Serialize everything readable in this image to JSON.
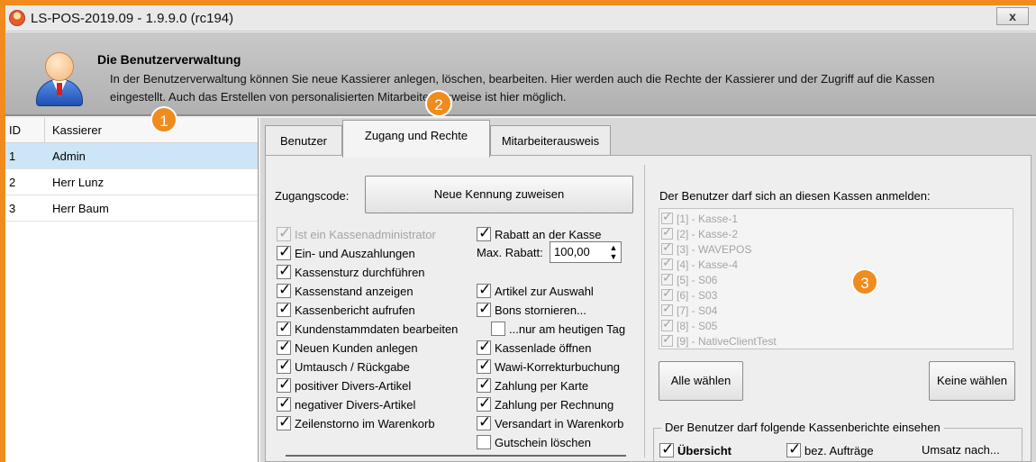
{
  "window": {
    "title": "LS-POS-2019.09 - 1.9.9.0 (rc194)",
    "close_label": "x"
  },
  "header": {
    "title": "Die Benutzerverwaltung",
    "description": "In der Benutzerverwaltung können Sie neue Kassierer anlegen, löschen, bearbeiten. Hier werden auch die Rechte der Kassierer und der Zugriff auf die Kassen eingestellt. Auch das Erstellen von personalisierten Mitarbeiterausweise ist hier möglich."
  },
  "userlist": {
    "columns": [
      "ID",
      "Kassierer"
    ],
    "rows": [
      {
        "id": "1",
        "name": "Admin",
        "selected": true
      },
      {
        "id": "2",
        "name": "Herr Lunz",
        "selected": false
      },
      {
        "id": "3",
        "name": "Herr Baum",
        "selected": false
      }
    ]
  },
  "badges": [
    "1",
    "2",
    "3"
  ],
  "tabs": [
    {
      "label": "Benutzer",
      "active": false
    },
    {
      "label": "Zugang und Rechte",
      "active": true
    },
    {
      "label": "Mitarbeiterausweis",
      "active": false
    }
  ],
  "access": {
    "code_label": "Zugangscode:",
    "assign_button": "Neue Kennung zuweisen",
    "max_rabatt_label": "Max. Rabatt:",
    "max_rabatt_value": "100,00"
  },
  "rights_left": [
    {
      "label": "Ist ein Kassenadministrator",
      "checked": true,
      "disabled": true
    },
    {
      "label": "Ein- und Auszahlungen",
      "checked": true,
      "disabled": false
    },
    {
      "label": "Kassensturz durchführen",
      "checked": true,
      "disabled": false
    },
    {
      "label": "Kassenstand anzeigen",
      "checked": true,
      "disabled": false
    },
    {
      "label": "Kassenbericht aufrufen",
      "checked": true,
      "disabled": false
    },
    {
      "label": "Kundenstammdaten bearbeiten",
      "checked": true,
      "disabled": false
    },
    {
      "label": "Neuen Kunden anlegen",
      "checked": true,
      "disabled": false
    },
    {
      "label": "Umtausch / Rückgabe",
      "checked": true,
      "disabled": false
    },
    {
      "label": "positiver Divers-Artikel",
      "checked": true,
      "disabled": false
    },
    {
      "label": "negativer Divers-Artikel",
      "checked": true,
      "disabled": false
    },
    {
      "label": "Zeilenstorno im Warenkorb",
      "checked": true,
      "disabled": false
    }
  ],
  "rights_right": [
    {
      "label": "Rabatt an der Kasse",
      "checked": true
    },
    {
      "label": "Artikel zur Auswahl",
      "checked": true
    },
    {
      "label": "Bons stornieren...",
      "checked": true
    },
    {
      "label": "...nur am heutigen Tag",
      "checked": false
    },
    {
      "label": "Kassenlade öffnen",
      "checked": true
    },
    {
      "label": "Wawi-Korrekturbuchung",
      "checked": true
    },
    {
      "label": "Zahlung per Karte",
      "checked": true
    },
    {
      "label": "Zahlung per Rechnung",
      "checked": true
    },
    {
      "label": "Versandart in Warenkorb",
      "checked": true
    },
    {
      "label": "Gutschein löschen",
      "checked": false
    }
  ],
  "kassen": {
    "label": "Der Benutzer darf sich an diesen Kassen anmelden:",
    "items": [
      "[1] - Kasse-1",
      "[2] - Kasse-2",
      "[3] - WAVEPOS",
      "[4] - Kasse-4",
      "[5] - S06",
      "[6] - S03",
      "[7] - S04",
      "[8] - S05",
      "[9] - NativeClientTest"
    ],
    "select_all": "Alle wählen",
    "select_none": "Keine wählen"
  },
  "reports": {
    "title": "Der Benutzer darf folgende Kassenberichte einsehen",
    "overview": "Übersicht",
    "orders": "bez. Aufträge",
    "umsatz": "Umsatz nach..."
  }
}
